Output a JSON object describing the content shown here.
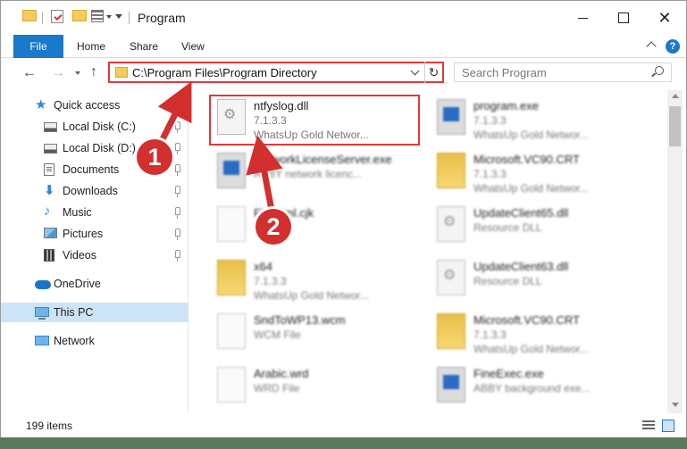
{
  "window": {
    "title": "Program",
    "close_glyph": "✕"
  },
  "ribbon": {
    "tabs": [
      "File",
      "Home",
      "Share",
      "View"
    ],
    "help_glyph": "?"
  },
  "nav": {
    "back_glyph": "←",
    "forward_glyph": "→",
    "up_glyph": "↑",
    "address": "C:\\Program Files\\Program Directory",
    "refresh_glyph": "↻",
    "search_placeholder": "Search Program"
  },
  "sidebar": {
    "items": [
      {
        "label": "Quick access",
        "icon": "star-icon",
        "glyph": "★"
      },
      {
        "label": "Local Disk (C:)",
        "icon": "disk-icon",
        "pinned": true
      },
      {
        "label": "Local Disk (D:)",
        "icon": "disk-icon",
        "pinned": true
      },
      {
        "label": "Documents",
        "icon": "documents-icon",
        "pinned": true
      },
      {
        "label": "Downloads",
        "icon": "download-icon",
        "glyph": "⬇",
        "pinned": true
      },
      {
        "label": "Music",
        "icon": "music-icon",
        "glyph": "♪",
        "pinned": true
      },
      {
        "label": "Pictures",
        "icon": "pictures-icon",
        "pinned": true
      },
      {
        "label": "Videos",
        "icon": "videos-icon",
        "pinned": true
      },
      {
        "label": "OneDrive",
        "icon": "cloud-icon"
      },
      {
        "label": "This PC",
        "icon": "computer-icon",
        "selected": true
      },
      {
        "label": "Network",
        "icon": "network-icon"
      }
    ]
  },
  "files": [
    {
      "name": "ntfyslog.dll",
      "line1": "7.1.3.3",
      "line2": "WhatsUp Gold Networ...",
      "icon": "dll-icon",
      "highlighted": true
    },
    {
      "name": "program.exe",
      "line1": "7.1.3.3",
      "line2": "WhatsUp Gold Networ...",
      "icon": "exe-icon"
    },
    {
      "name": "NetworkLicenseServer.exe",
      "line1": "ABBY network licenc...",
      "line2": "",
      "icon": "exe-icon"
    },
    {
      "name": "Microsoft.VC90.CRT",
      "line1": "7.1.3.3",
      "line2": "WhatsUp Gold Networ...",
      "icon": "folder-icon"
    },
    {
      "name": "FineXml.cjk",
      "line1": "",
      "line2": "",
      "icon": "file-icon"
    },
    {
      "name": "UpdateClient65.dll",
      "line1": "Resource DLL",
      "line2": "",
      "icon": "dll-icon"
    },
    {
      "name": "x64",
      "line1": "7.1.3.3",
      "line2": "WhatsUp Gold Networ...",
      "icon": "folder-icon"
    },
    {
      "name": "UpdateClient63.dll",
      "line1": "Resource DLL",
      "line2": "",
      "icon": "dll-icon"
    },
    {
      "name": "SndToWP13.wcm",
      "line1": "WCM File",
      "line2": "",
      "icon": "file-icon"
    },
    {
      "name": "Microsoft.VC90.CRT",
      "line1": "7.1.3.3",
      "line2": "WhatsUp Gold Networ...",
      "icon": "folder-icon"
    },
    {
      "name": "Arabic.wrd",
      "line1": "WRD File",
      "line2": "",
      "icon": "file-icon"
    },
    {
      "name": "FineExec.exe",
      "line1": "ABBY background exe...",
      "line2": "",
      "icon": "exe-icon"
    }
  ],
  "status": {
    "item_count": "199 items"
  },
  "annotations": {
    "badge_1": "1",
    "badge_2": "2",
    "color": "#d22f2f"
  }
}
